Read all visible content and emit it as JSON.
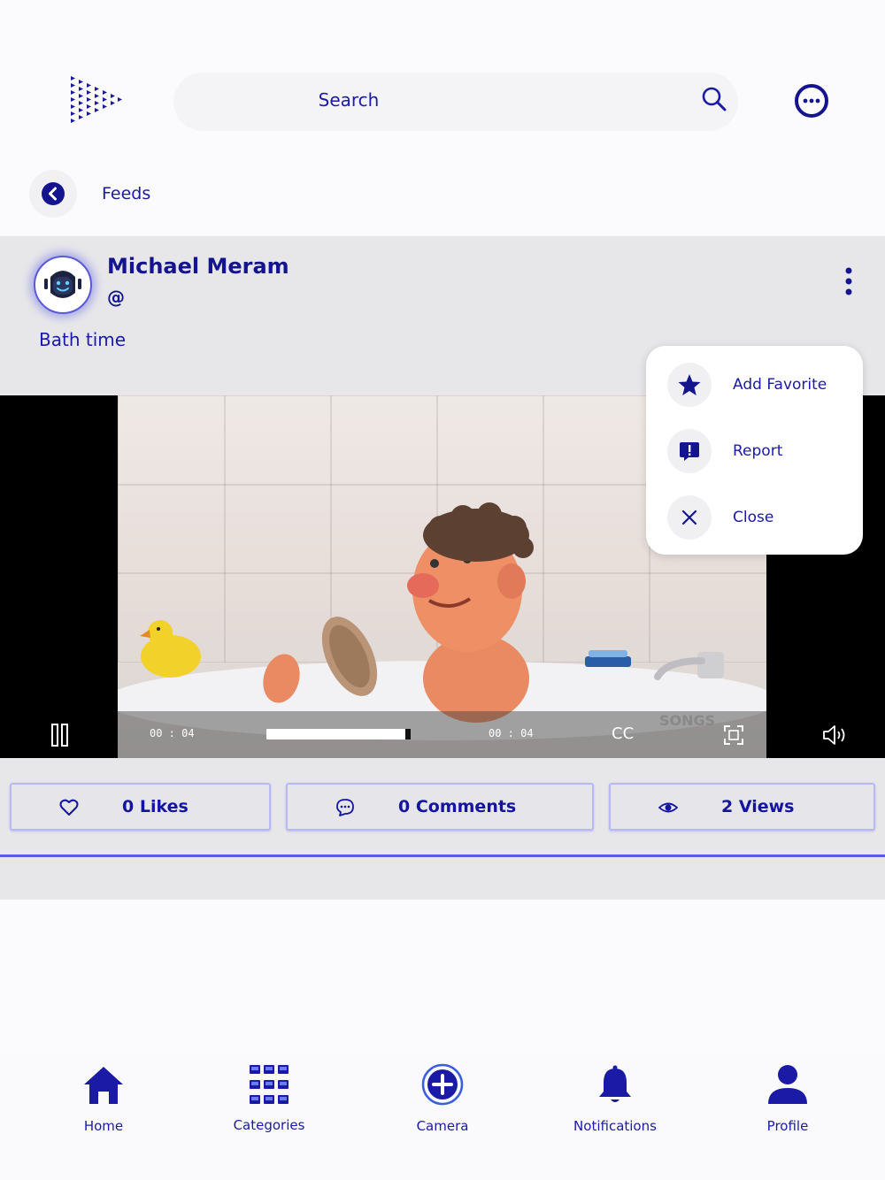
{
  "search": {
    "placeholder": "Search"
  },
  "nav": {
    "back_label": "Feeds"
  },
  "post": {
    "author_name": "Michael Meram",
    "author_handle": "@",
    "caption": "Bath time"
  },
  "video": {
    "elapsed": "00 : 04",
    "duration": "00 : 04",
    "cc_label": "CC",
    "progress": 1.0,
    "watermark": "SONGS"
  },
  "stats": {
    "likes": "0 Likes",
    "comments": "0 Comments",
    "views": "2 Views"
  },
  "menu": {
    "items": [
      {
        "label": "Add Favorite",
        "icon": "star-icon"
      },
      {
        "label": "Report",
        "icon": "report-icon"
      },
      {
        "label": "Close",
        "icon": "close-icon"
      }
    ]
  },
  "tabbar": {
    "items": [
      {
        "label": "Home",
        "icon": "home-icon"
      },
      {
        "label": "Categories",
        "icon": "grid-icon"
      },
      {
        "label": "Camera",
        "icon": "plus-circle-icon"
      },
      {
        "label": "Notifications",
        "icon": "bell-icon"
      },
      {
        "label": "Profile",
        "icon": "person-icon"
      }
    ]
  },
  "colors": {
    "accent": "#1a1aa6",
    "panel": "#e7e7ea",
    "outline": "#b8b8f2"
  }
}
